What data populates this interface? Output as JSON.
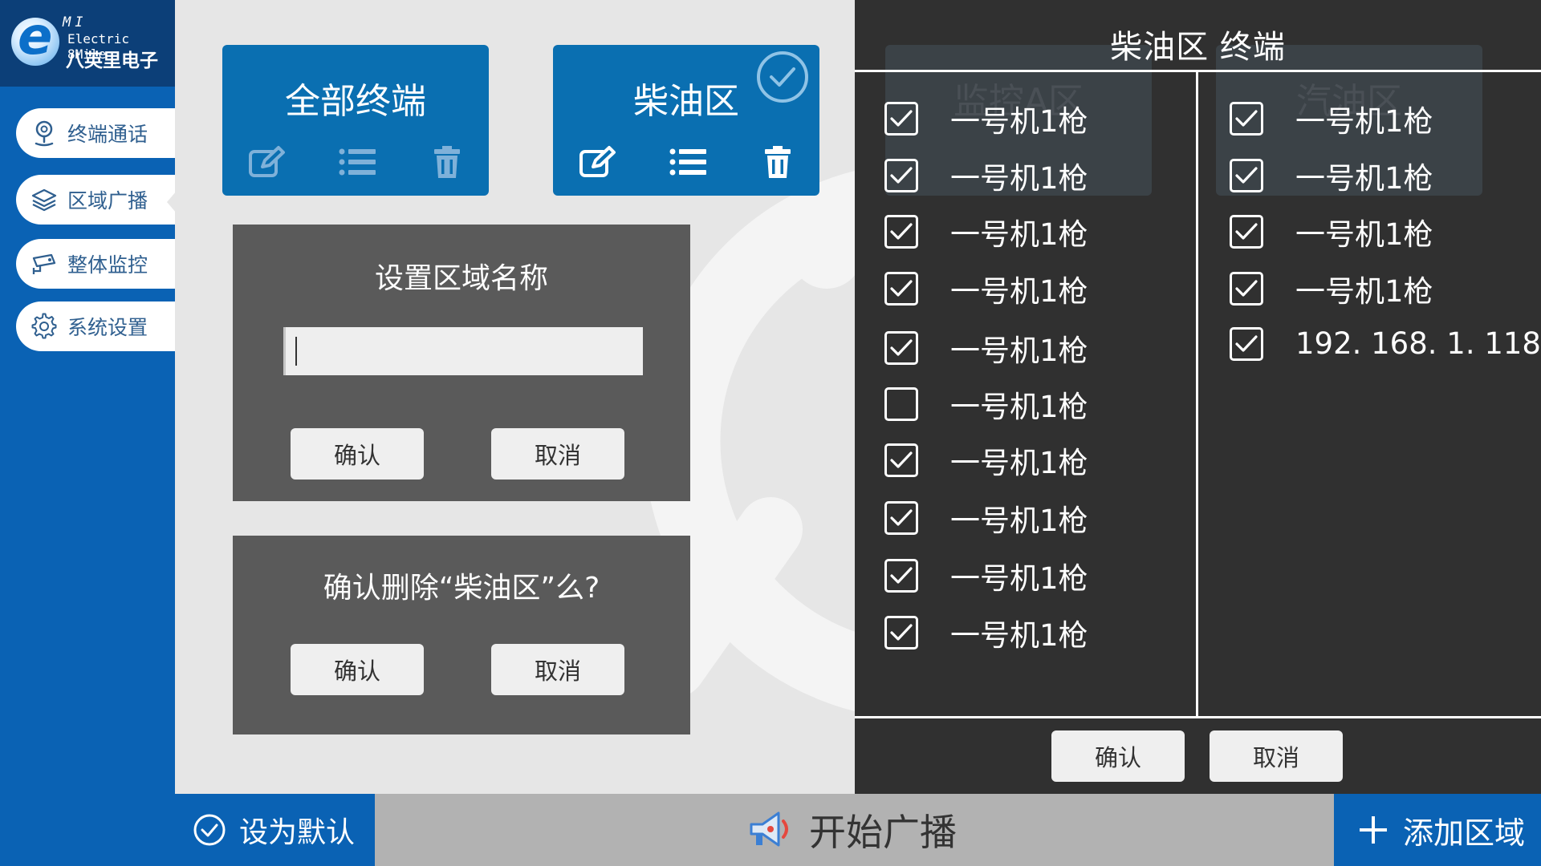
{
  "logo": {
    "mi": "MI",
    "en": "Electric 8Mile",
    "cn": "八英里电子",
    "letter": "e"
  },
  "sidebar": {
    "items": [
      {
        "label": "终端通话",
        "icon": "location-pin-icon"
      },
      {
        "label": "区域广播",
        "icon": "layers-icon"
      },
      {
        "label": "整体监控",
        "icon": "cctv-camera-icon"
      },
      {
        "label": "系统设置",
        "icon": "gear-icon"
      }
    ],
    "active_index": 1
  },
  "zones": [
    {
      "title": "全部终端",
      "selected": false
    },
    {
      "title": "柴油区",
      "selected": true
    }
  ],
  "rename_dialog": {
    "title": "设置区域名称",
    "value": "",
    "confirm": "确认",
    "cancel": "取消"
  },
  "delete_dialog": {
    "title": "确认删除“柴油区”么?",
    "confirm": "确认",
    "cancel": "取消"
  },
  "terminal_panel": {
    "title": "柴油区 终端",
    "ghost_zones": [
      "监控A区",
      "汽油区"
    ],
    "left_list": [
      {
        "label": "一号机1枪",
        "checked": true
      },
      {
        "label": "一号机1枪",
        "checked": true
      },
      {
        "label": "一号机1枪",
        "checked": true
      },
      {
        "label": "一号机1枪",
        "checked": true
      },
      {
        "label": "一号机1枪",
        "checked": true
      },
      {
        "label": "一号机1枪",
        "checked": false
      },
      {
        "label": "一号机1枪",
        "checked": true
      },
      {
        "label": "一号机1枪",
        "checked": true
      },
      {
        "label": "一号机1枪",
        "checked": true
      },
      {
        "label": "一号机1枪",
        "checked": true
      }
    ],
    "right_list": [
      {
        "label": "一号机1枪",
        "checked": true
      },
      {
        "label": "一号机1枪",
        "checked": true
      },
      {
        "label": "一号机1枪",
        "checked": true
      },
      {
        "label": "一号机1枪",
        "checked": true
      },
      {
        "label": "192. 168. 1. 118",
        "checked": true
      }
    ],
    "confirm": "确认",
    "cancel": "取消"
  },
  "bottom_bar": {
    "set_default": "设为默认",
    "start_broadcast": "开始广播",
    "add_zone": "添加区域"
  },
  "colors": {
    "primary_blue": "#0a62b4",
    "card_blue": "#0a6fb1",
    "dark_panel": "#303030",
    "dialog_gray": "#5a5a5a",
    "logo_navy": "#0c3f78"
  }
}
